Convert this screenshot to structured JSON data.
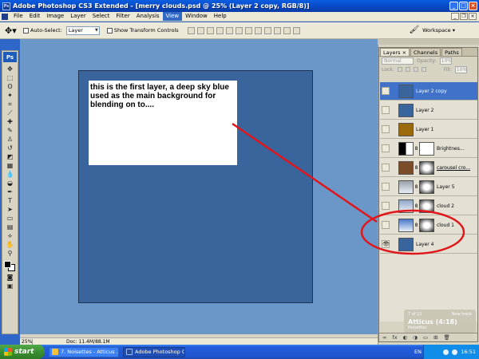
{
  "window": {
    "title": "Adobe Photoshop CS3 Extended - [merry clouds.psd @ 25% (Layer 2 copy, RGB/8)]"
  },
  "menu": {
    "items": [
      "File",
      "Edit",
      "Image",
      "Layer",
      "Select",
      "Filter",
      "Analysis",
      "View",
      "Window",
      "Help"
    ],
    "active": "View"
  },
  "options": {
    "auto_select_label": "Auto-Select:",
    "auto_select_value": "Layer",
    "show_transform_label": "Show Transform Controls",
    "workspace_label": "Workspace ▾"
  },
  "toolbox": {
    "logo": "Ps"
  },
  "canvas": {
    "background_color": "#3a659c",
    "annotation_text": "this is the first layer, a deep sky blue used as the main background for blending on to...."
  },
  "status": {
    "zoom": "25%",
    "doc": "Doc: 11.4M/88.1M"
  },
  "layers_panel": {
    "tabs": [
      "Layers ×",
      "Channels",
      "Paths"
    ],
    "active_tab": "Layers ×",
    "blend_mode": "Normal",
    "opacity_label": "Opacity:",
    "opacity_value": "10%",
    "lock_label": "Lock:",
    "fill_label": "Fill:",
    "fill_value": "10%",
    "layers": [
      {
        "name": "Layer 2 copy",
        "thumb": "#3a659c",
        "selected": true,
        "visible": false,
        "mask": false,
        "underline": false
      },
      {
        "name": "Layer 2",
        "thumb": "#3a659c",
        "selected": false,
        "visible": false,
        "mask": false,
        "underline": false
      },
      {
        "name": "Layer 1",
        "thumb": "#9a6a0c",
        "selected": false,
        "visible": false,
        "mask": false,
        "underline": false
      },
      {
        "name": "Brightnes...",
        "thumb": "adjustment",
        "selected": false,
        "visible": false,
        "mask": true,
        "underline": false
      },
      {
        "name": "carousel cro...",
        "thumb": "#7a4c2a",
        "selected": false,
        "visible": false,
        "mask": true,
        "underline": true
      },
      {
        "name": "Layer 5",
        "thumb": "#9aa0a8",
        "selected": false,
        "visible": false,
        "mask": true,
        "underline": false
      },
      {
        "name": "cloud 2",
        "thumb": "#8fa6c8",
        "selected": false,
        "visible": false,
        "mask": true,
        "underline": false
      },
      {
        "name": "cloud 1",
        "thumb": "#4a78c8",
        "selected": false,
        "visible": false,
        "mask": true,
        "underline": false
      },
      {
        "name": "Layer 4",
        "thumb": "#3a659c",
        "selected": false,
        "visible": true,
        "mask": false,
        "underline": false
      }
    ],
    "footer_icons": [
      "∞",
      "fx",
      "◐",
      "◑",
      "▭",
      "⊞",
      "🗑"
    ]
  },
  "notification": {
    "line1_left": "7 of 11",
    "line1_right": "New track",
    "title": "Atticus (4:18)",
    "subtitle": "Noisettes"
  },
  "taskbar": {
    "start_label": "start",
    "tasks": [
      "7. Noisettes - Atticus ...",
      "Adobe Photoshop CS..."
    ],
    "lang": "EN",
    "clock": "16:51"
  },
  "colors": {
    "annotation_stroke": "#e0161b",
    "selected_layer": "#3f72c8"
  }
}
